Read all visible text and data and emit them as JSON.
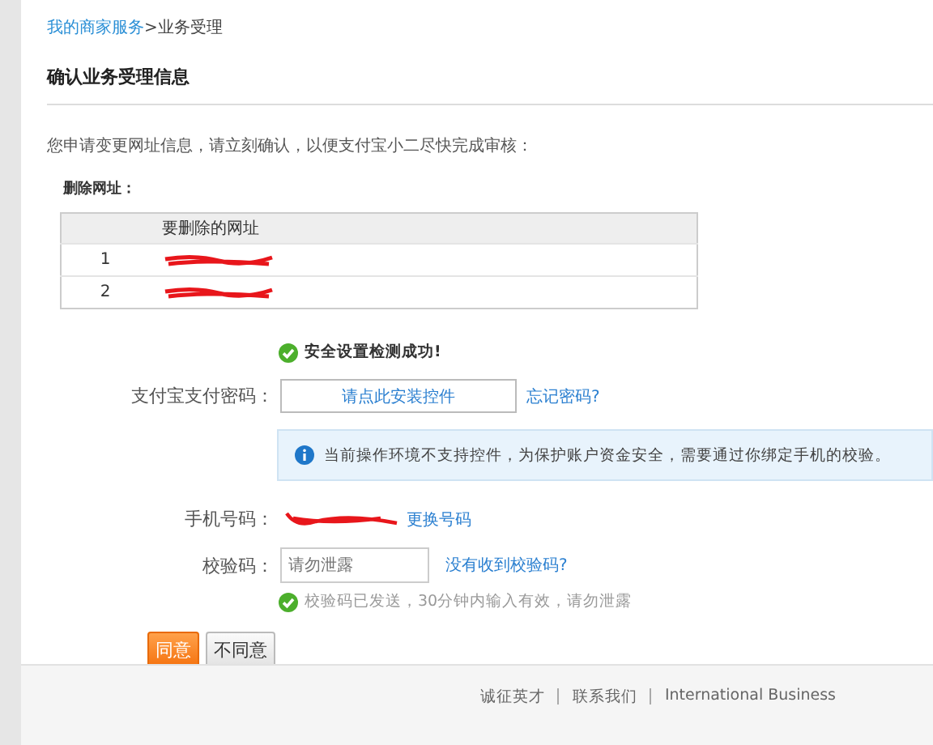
{
  "breadcrumb": {
    "link": "我的商家服务",
    "separator": ">",
    "current": "业务受理"
  },
  "title": "确认业务受理信息",
  "intro": "您申请变更网址信息，请立刻确认，以便支付宝小二尽快完成审核：",
  "section_label": "删除网址：",
  "table": {
    "columns": [
      "要删除的网址"
    ],
    "rows": [
      {
        "index": "1",
        "redacted": true
      },
      {
        "index": "2",
        "redacted": true
      }
    ]
  },
  "check_message": "安全设置检测成功!",
  "password": {
    "label": "支付宝支付密码：",
    "button": "请点此安装控件",
    "link": "忘记密码?"
  },
  "notice": "当前操作环境不支持控件，为保护账户资金安全，需要通过你绑定手机的校验。",
  "phone": {
    "label": "手机号码：",
    "redacted": true,
    "link": "更换号码"
  },
  "code": {
    "label": "校验码：",
    "placeholder": "请勿泄露",
    "link": "没有收到校验码?",
    "hint": "校验码已发送，30分钟内输入有效，请勿泄露"
  },
  "buttons": [
    {
      "label": "同意",
      "kind": "primary"
    },
    {
      "label": "不同意",
      "kind": "secondary"
    }
  ],
  "footer_links": [
    "诚征英才",
    "联系我们",
    "International Business"
  ]
}
